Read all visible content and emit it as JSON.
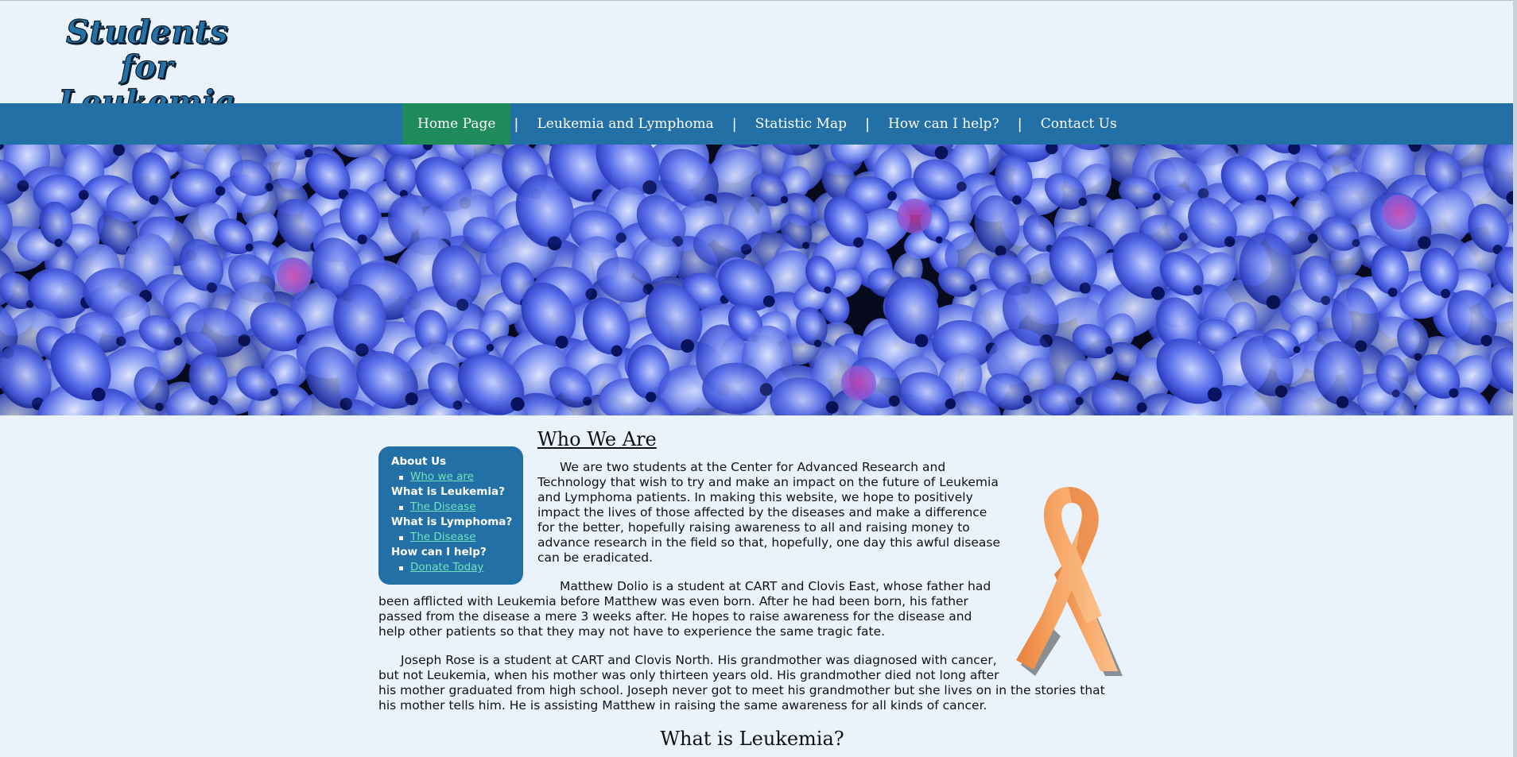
{
  "header": {
    "logo_line1": "Students for",
    "logo_line2": "Leukemia"
  },
  "nav": {
    "items": [
      {
        "label": "Home Page",
        "active": true
      },
      {
        "label": "Leukemia and Lymphoma",
        "active": false
      },
      {
        "label": "Statistic Map",
        "active": false
      },
      {
        "label": "How can I help?",
        "active": false
      },
      {
        "label": "Contact Us",
        "active": false
      }
    ],
    "separator": "|"
  },
  "banner": {
    "image": "blue-hydrangea-flowers"
  },
  "sidebar": {
    "sections": [
      {
        "heading": "About Us",
        "link": "Who we are"
      },
      {
        "heading": "What is Leukemia?",
        "link": "The Disease"
      },
      {
        "heading": "What is Lymphoma?",
        "link": "The Disease"
      },
      {
        "heading": "How can I help?",
        "link": "Donate Today"
      }
    ]
  },
  "main": {
    "title": "Who We Are",
    "paragraphs": [
      "We are two students at the Center for Advanced Research and Technology that wish to try and make an impact on the future of Leukemia and Lymphoma patients. In making this website, we hope to positively impact the lives of those affected by the diseases and make a difference for the better, hopefully raising awareness to all and raising money to advance research in the field so that, hopefully, one day this awful disease can be eradicated.",
      "Matthew Dolio is a student at CART and Clovis East, whose father had been afflicted with Leukemia before Matthew was even born. After he had been born, his father passed from the disease a mere 3 weeks after. He hopes to raise awareness for the disease and help other patients so that they may not have to experience the same tragic fate.",
      "Joseph Rose is a student at CART and Clovis North. His grandmother was diagnosed with cancer, but not Leukemia, when his mother was only thirteen years old. His grandmother died not long after his mother graduated from high school. Joseph never got to meet his grandmother but she lives on in the stories that his mother tells him. He is assisting Matthew in raising the same awareness for all kinds of cancer."
    ],
    "next_title": "What is Leukemia?"
  },
  "colors": {
    "page_bg": "#eaf3fb",
    "nav_bg": "#2370a6",
    "nav_active": "#1f8a5a",
    "sidebar_link": "#6fe3bf",
    "ribbon": "#f4a060"
  }
}
